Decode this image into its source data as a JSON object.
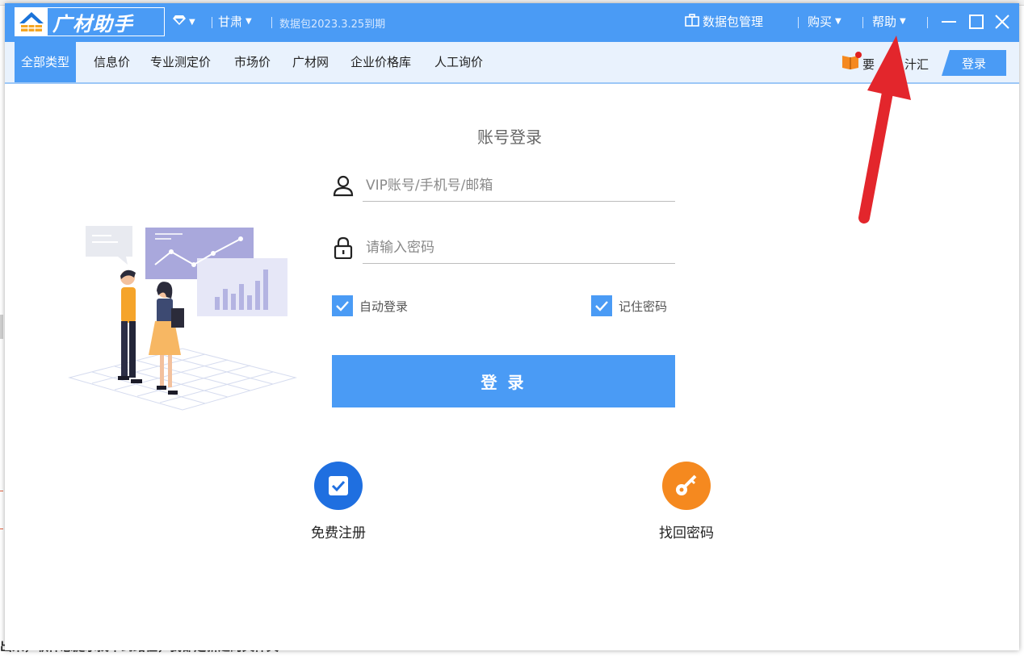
{
  "background": {
    "bottom_text": "出来，软件总提示找不到路径，我都是新建的文件夹"
  },
  "titlebar": {
    "logo_text": "广材助手",
    "region": "甘肃",
    "data_package": "数据包2023.3.25到期",
    "data_manage": "数据包管理",
    "buy": "购买",
    "help": "帮助"
  },
  "nav": {
    "items": [
      "全部类型",
      "信息价",
      "专业测定价",
      "市场价",
      "广材网",
      "企业价格库",
      "人工询价"
    ],
    "right_text": "要",
    "right_text_2": "汁汇",
    "login": "登录"
  },
  "form": {
    "title": "账号登录",
    "account_placeholder": "VIP账号/手机号/邮箱",
    "password_placeholder": "请输入密码",
    "auto_login": "自动登录",
    "remember": "记住密码",
    "submit": "登 录"
  },
  "links": {
    "register": "免费注册",
    "recover": "找回密码"
  },
  "colors": {
    "primary": "#4a9bf5",
    "orange": "#f5891f",
    "annotation_arrow": "#e3262c"
  }
}
